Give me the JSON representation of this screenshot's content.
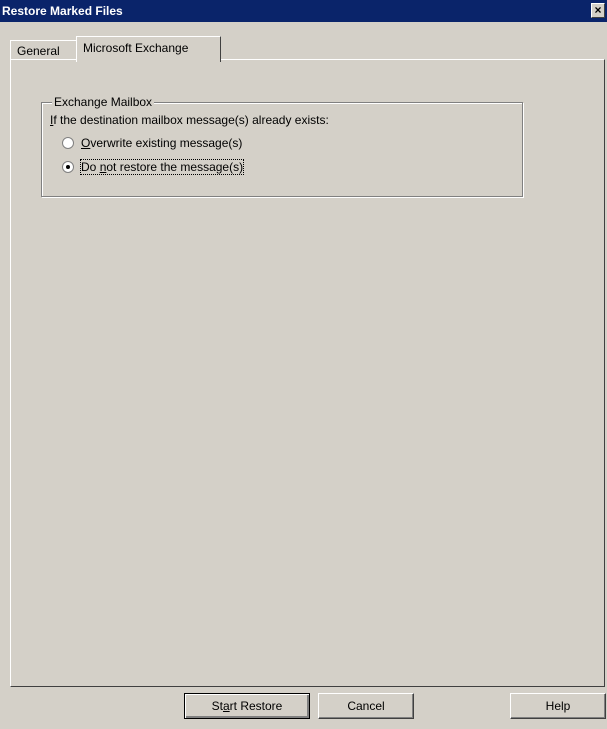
{
  "window": {
    "title": "Restore Marked Files",
    "close_label": "×"
  },
  "tabs": [
    {
      "label": "General",
      "active": false
    },
    {
      "label": "Microsoft Exchange",
      "active": true
    }
  ],
  "exchange_mailbox": {
    "group_title": "Exchange Mailbox",
    "prompt_access_key": "I",
    "prompt_rest": "f the destination mailbox message(s) already exists:",
    "options": [
      {
        "access_key": "O",
        "label_rest": "verwrite existing message(s)",
        "selected": false
      },
      {
        "label_pre": "Do ",
        "access_key": "n",
        "label_rest": "ot restore the message(s)",
        "selected": true
      }
    ]
  },
  "buttons": {
    "start_restore_pre": "St",
    "start_restore_key": "a",
    "start_restore_post": "rt Restore",
    "cancel": "Cancel",
    "help": "Help"
  },
  "colors": {
    "title_bar": "#0a246a",
    "dialog_face": "#d4d0c8"
  }
}
